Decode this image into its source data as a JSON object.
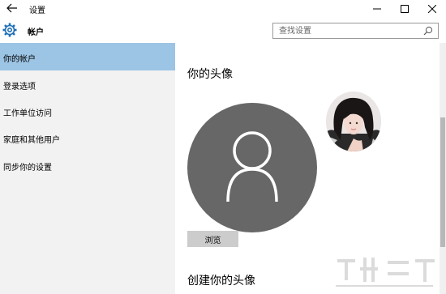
{
  "titlebar": {
    "app_title": "设置",
    "back_icon": "back-arrow-icon",
    "minimize_icon": "minimize-icon",
    "maximize_icon": "maximize-icon",
    "close_icon": "close-icon"
  },
  "header": {
    "icon": "gear-icon",
    "title": "帐户",
    "search_placeholder": "查找设置",
    "search_icon": "search-icon"
  },
  "sidebar": {
    "items": [
      {
        "label": "你的帐户",
        "active": true
      },
      {
        "label": "登录选项",
        "active": false
      },
      {
        "label": "工作单位访问",
        "active": false
      },
      {
        "label": "家庭和其他用户",
        "active": false
      },
      {
        "label": "同步你的设置",
        "active": false
      }
    ]
  },
  "main": {
    "avatar_title": "你的头像",
    "default_avatar_icon": "user-icon",
    "browse_label": "浏览",
    "create_avatar_title": "创建你的头像"
  },
  "colors": {
    "sidebar_bg": "#f2f2f2",
    "active_item_bg": "#9cc4e4",
    "avatar_bg": "#676767",
    "button_bg": "#cccccc"
  }
}
